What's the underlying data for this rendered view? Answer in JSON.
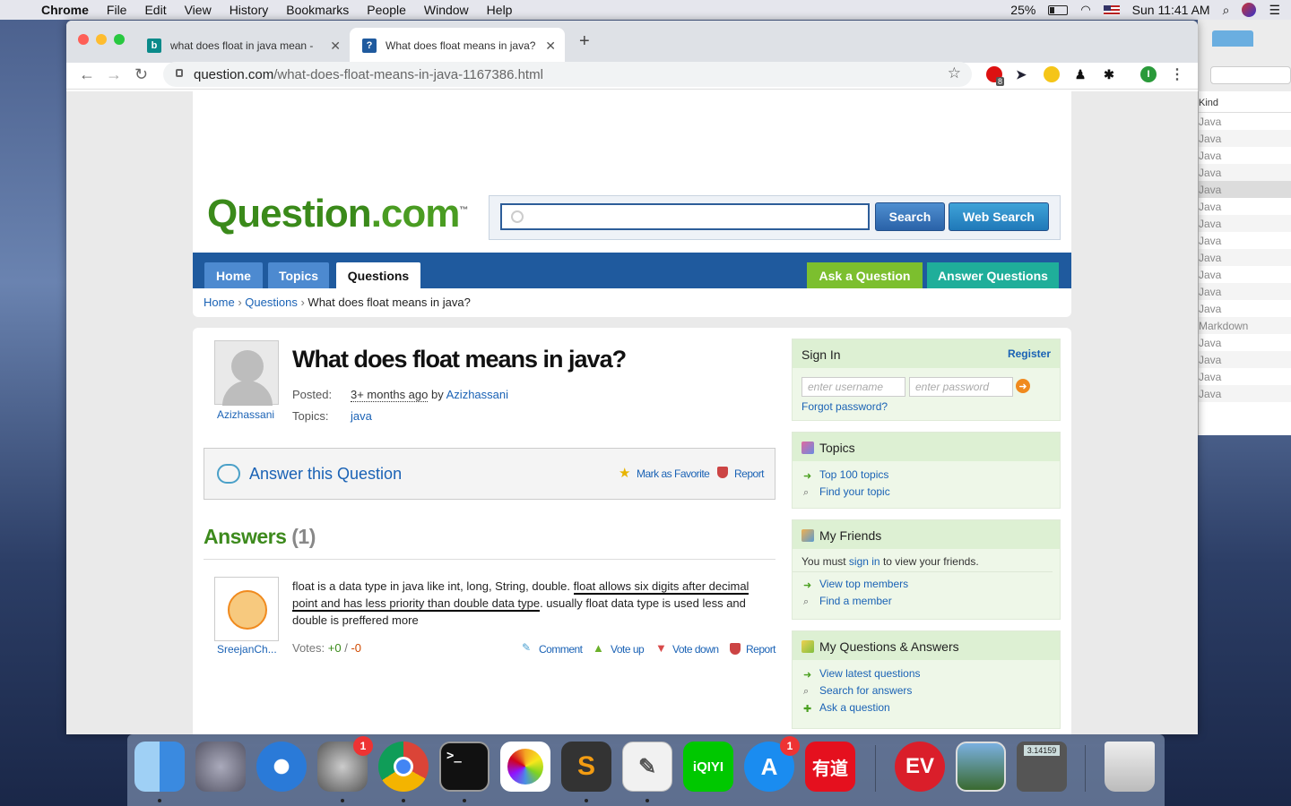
{
  "menubar": {
    "app": "Chrome",
    "items": [
      "File",
      "Edit",
      "View",
      "History",
      "Bookmarks",
      "People",
      "Window",
      "Help"
    ],
    "battery": "25%",
    "clock": "Sun 11:41 AM"
  },
  "finder": {
    "column_header": "Kind",
    "rows": [
      "Java",
      "Java",
      "Java",
      "Java",
      "Java",
      "Java",
      "Java",
      "Java",
      "Java",
      "Java",
      "Java",
      "Java",
      "Markdown",
      "Java",
      "Java",
      "Java",
      "Java"
    ]
  },
  "tabs": [
    {
      "title": "what does float in java mean -",
      "icon": "bing-icon"
    },
    {
      "title": "What does float means in java?",
      "icon": "question-com-icon"
    }
  ],
  "address": {
    "domain": "question.com",
    "path": "/what-does-float-means-in-java-1167386.html",
    "ext_badge": "8",
    "profile_initial": "I"
  },
  "site": {
    "logo_main": "Question",
    "logo_tld": ".com",
    "logo_tm": "™",
    "search_button": "Search",
    "web_search_button": "Web Search",
    "nav": [
      "Home",
      "Topics",
      "Questions"
    ],
    "ask_button": "Ask a Question",
    "answer_button": "Answer Questions",
    "crumb_home": "Home",
    "crumb_sep": "›",
    "crumb_questions": "Questions",
    "crumb_current": "What does float means in java?"
  },
  "question": {
    "asker": "Azizhassani",
    "title": "What does float means in java?",
    "posted_label": "Posted:",
    "posted_time": "3+ months ago",
    "by": "by",
    "author": "Azizhassani",
    "topics_label": "Topics:",
    "topic": "java",
    "answer_link": "Answer this Question",
    "mark_favorite": "Mark as Favorite",
    "report": "Report"
  },
  "answers": {
    "heading": "Answers",
    "count": "(1)",
    "items": [
      {
        "user": "SreejanCh...",
        "text_start": "float is a data type in java like int, long, String, double. ",
        "text_underlined": "float allows six digits after decimal point and has less priority than double data type",
        "text_end": ". usually float data type is used less and double is preffered more",
        "votes_label": "Votes:",
        "up": "+0",
        "sep": "/",
        "down": "-0",
        "actions": [
          "Comment",
          "Vote up",
          "Vote down",
          "Report"
        ]
      }
    ]
  },
  "sidebar": {
    "signin": {
      "title": "Sign In",
      "register": "Register",
      "username_placeholder": "enter username",
      "password_placeholder": "enter password",
      "forgot": "Forgot password?"
    },
    "topics": {
      "title": "Topics",
      "links": [
        "Top 100 topics",
        "Find your topic"
      ]
    },
    "friends": {
      "title": "My Friends",
      "note_before": "You must ",
      "note_link": "sign in",
      "note_after": " to view your friends.",
      "links": [
        "View top members",
        "Find a member"
      ]
    },
    "qa": {
      "title": "My Questions & Answers",
      "links": [
        "View latest questions",
        "Search for answers",
        "Ask a question"
      ]
    }
  },
  "dock": {
    "apps": [
      "Finder",
      "Launchpad",
      "Safari",
      "System Preferences",
      "Chrome",
      "Terminal",
      "Photos",
      "Sublime Text",
      "TextEdit",
      "iQIYI",
      "App Store",
      "Youdao",
      "ExpressVPN",
      "Preview",
      "Calculator",
      "Trash"
    ],
    "badge_prefs": "1",
    "badge_appstore": "1",
    "terminal_prompt": ">_",
    "iqiyi_label": "iQIYI",
    "youdao_label": "有道",
    "calc_display": "3.14159"
  },
  "colors": {
    "site_green": "#3a8a1a",
    "nav_blue": "#1f5a9e",
    "link_blue": "#1a62b5",
    "ask_green": "#7cbf2e",
    "answer_teal": "#1fae9a"
  }
}
